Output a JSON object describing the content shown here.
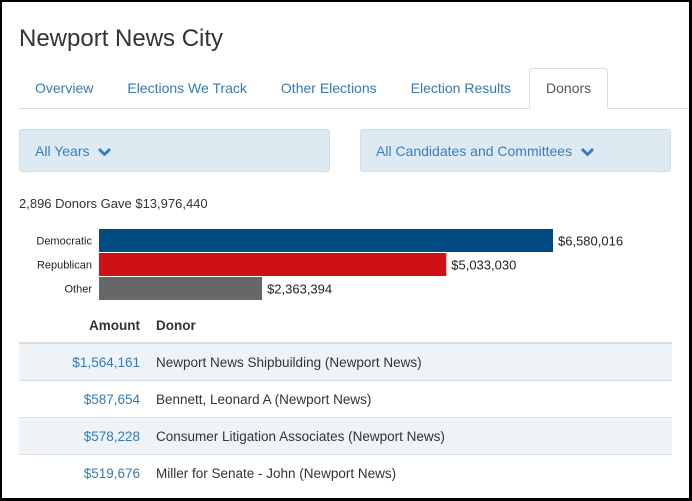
{
  "page": {
    "title": "Newport News City"
  },
  "tabs": [
    {
      "label": "Overview",
      "active": false
    },
    {
      "label": "Elections We Track",
      "active": false
    },
    {
      "label": "Other Elections",
      "active": false
    },
    {
      "label": "Election Results",
      "active": false
    },
    {
      "label": "Donors",
      "active": true
    }
  ],
  "filters": {
    "years": {
      "label": "All Years",
      "icon": "chevron-down-icon"
    },
    "candidates": {
      "label": "All Candidates and Committees",
      "icon": "chevron-down-icon"
    }
  },
  "summary": "2,896 Donors Gave $13,976,440",
  "colors": {
    "democratic": "#024a82",
    "republican": "#cd1114",
    "other": "#676767",
    "link": "#337ab7",
    "filter_bg": "#deeaf1"
  },
  "chart_data": {
    "type": "bar",
    "orientation": "horizontal",
    "categories": [
      "Democratic",
      "Republican",
      "Other"
    ],
    "values": [
      6580016,
      5033030,
      2363394
    ],
    "value_labels": [
      "$6,580,016",
      "$5,033,030",
      "$2,363,394"
    ],
    "colors": [
      "#024a82",
      "#cd1114",
      "#676767"
    ],
    "title": "",
    "xlabel": "",
    "ylabel": "",
    "grid": false
  },
  "table": {
    "headers": {
      "amount": "Amount",
      "donor": "Donor"
    },
    "rows": [
      {
        "amount": "$1,564,161",
        "donor": "Newport News Shipbuilding (Newport News)"
      },
      {
        "amount": "$587,654",
        "donor": "Bennett, Leonard A (Newport News)"
      },
      {
        "amount": "$578,228",
        "donor": "Consumer Litigation Associates (Newport News)"
      },
      {
        "amount": "$519,676",
        "donor": "Miller for Senate - John (Newport News)"
      }
    ]
  }
}
